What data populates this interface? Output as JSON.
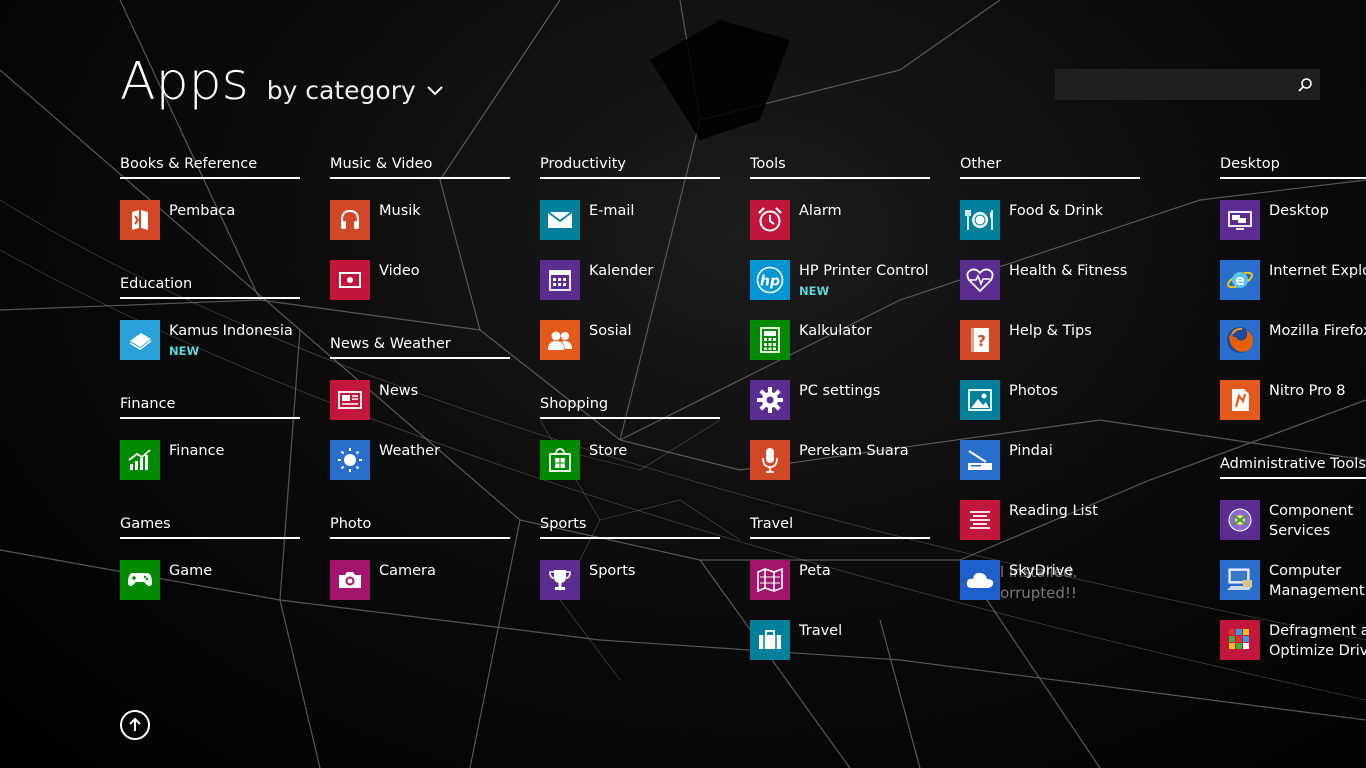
{
  "header": {
    "title": "Apps",
    "sort_label": "by category"
  },
  "search": {
    "value": "",
    "placeholder": ""
  },
  "categories": {
    "books": "Books & Reference",
    "education": "Education",
    "finance": "Finance",
    "games": "Games",
    "music": "Music & Video",
    "news": "News & Weather",
    "photo": "Photo",
    "productivity": "Productivity",
    "shopping": "Shopping",
    "sports": "Sports",
    "tools": "Tools",
    "travel": "Travel",
    "other": "Other",
    "desktop": "Desktop",
    "admin": "Administrative Tools"
  },
  "apps": {
    "pembaca": "Pembaca",
    "kamus": "Kamus Indonesia",
    "finance": "Finance",
    "game": "Game",
    "musik": "Musik",
    "video": "Video",
    "news": "News",
    "weather": "Weather",
    "camera": "Camera",
    "email": "E-mail",
    "kalender": "Kalender",
    "sosial": "Sosial",
    "store": "Store",
    "sports": "Sports",
    "alarm": "Alarm",
    "hp": "HP Printer Control",
    "kalkulator": "Kalkulator",
    "pcsettings": "PC settings",
    "perekam": "Perekam Suara",
    "peta": "Peta",
    "travel": "Travel",
    "food": "Food & Drink",
    "health": "Health & Fitness",
    "help": "Help & Tips",
    "photos": "Photos",
    "pindai": "Pindai",
    "reading": "Reading List",
    "skydrive": "SkyDrive",
    "desktop": "Desktop",
    "ie": "Internet Explorer",
    "firefox": "Mozilla Firefox",
    "nitro": "Nitro Pro 8",
    "component1": "Component",
    "component2": "Services",
    "computer1": "Computer",
    "computer2": "Management",
    "defrag1": "Defragment and",
    "defrag2": "Optimize Drives"
  },
  "badges": {
    "new": "NEW"
  },
  "ghost_text": {
    "line1": "l installed.",
    "line2": "orrupted!!"
  },
  "colors": {
    "orange": "#d24726",
    "cyan": "#2aa0d8",
    "green": "#008a00",
    "red": "#c1173d",
    "magenta": "#a2156c",
    "blue": "#2a6ecc",
    "teal": "#00809a",
    "purple": "#5c2d91",
    "orangebright": "#e35a1c",
    "darkblue": "#1e3d8f"
  }
}
